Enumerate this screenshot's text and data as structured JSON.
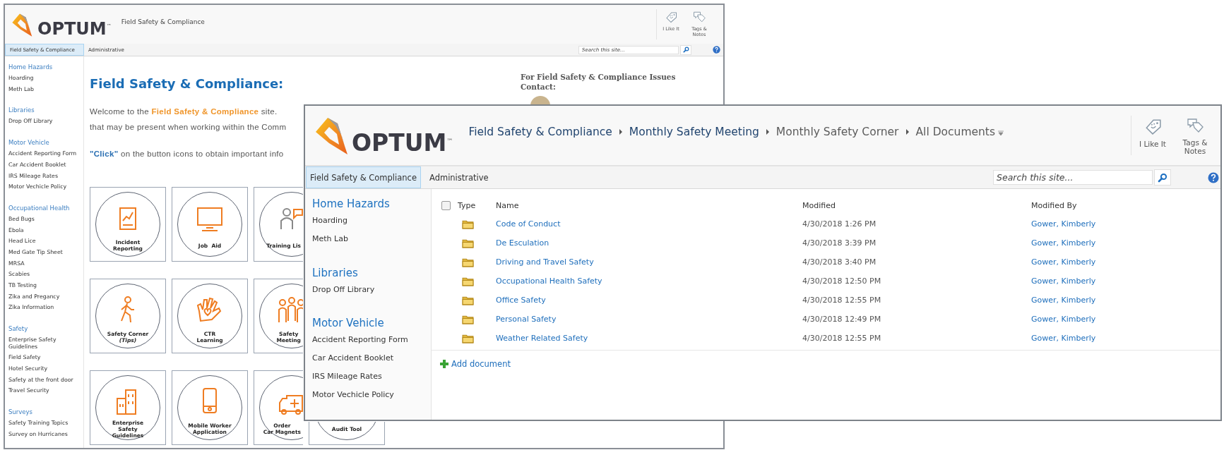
{
  "back_window": {
    "logo": {
      "wordmark": "OPTUM",
      "trademark": "™"
    },
    "site_title": "Field Safety & Compliance",
    "header_actions": [
      {
        "label": "I Like It",
        "kind": "like"
      },
      {
        "label": "Tags & Notes",
        "kind": "tags"
      }
    ],
    "tabs": [
      {
        "label": "Field Safety & Compliance",
        "selected": true
      },
      {
        "label": "Administrative",
        "selected": false
      }
    ],
    "search": {
      "placeholder": "Search this site..."
    },
    "sidebar": [
      {
        "heading": "Home Hazards",
        "items": [
          "Hoarding",
          "Meth Lab"
        ]
      },
      {
        "heading": "Libraries",
        "items": [
          "Drop Off Library"
        ]
      },
      {
        "heading": "Motor Vehicle",
        "items": [
          "Accident Reporting Form",
          "Car Accident Booklet",
          "IRS Mileage Rates",
          "Motor Vechicle Policy"
        ]
      },
      {
        "heading": "Occupational Health",
        "items": [
          "Bed Bugs",
          "Ebola",
          "Head Lice",
          "Med Gate Tip Sheet",
          "MRSA",
          "Scabies",
          "TB Testing",
          "Zika and Pregancy",
          "Zika Information"
        ]
      },
      {
        "heading": "Safety",
        "items": [
          "Enterprise Safety Guidelines",
          "Field Safety",
          "Hotel Security",
          "Safety at the front door",
          "Travel Security"
        ]
      },
      {
        "heading": "Surveys",
        "items": [
          "Safety Training Topics",
          "Survey on Hurricanes"
        ]
      }
    ],
    "page_title": "Field Safety & Compliance:",
    "intro": [
      "Welcome to the **Field Safety & Compliance** site.",
      "that may be present when working within the Comm"
    ],
    "instruction": "**\"Click\"** on the button icons to obtain important info",
    "tiles": [
      [
        {
          "lines": [
            "Incident",
            "Reporting"
          ]
        },
        {
          "lines": [
            "Job  Aid"
          ]
        },
        {
          "lines": [
            "Training Lis"
          ]
        }
      ],
      [
        {
          "lines": [
            "Safety Corner",
            "*(Tips)*"
          ]
        },
        {
          "lines": [
            "CTR",
            "Learning"
          ]
        },
        {
          "lines": [
            "Safety",
            "Meeting"
          ]
        }
      ],
      [
        {
          "lines": [
            "Enterprise",
            "Safety",
            "Guidelines"
          ]
        },
        {
          "lines": [
            "Mobile Worker",
            "Application"
          ]
        },
        {
          "lines": [
            "Order",
            "Car Magnets"
          ]
        },
        {
          "lines": [
            "Audit Tool"
          ]
        }
      ]
    ],
    "contact_heading": "For Field Safety & Compliance Issues Contact:"
  },
  "front_window": {
    "logo": {
      "wordmark": "OPTUM",
      "trademark": "™"
    },
    "breadcrumb": [
      {
        "label": "Field Safety & Compliance",
        "kind": "link"
      },
      {
        "label": "Monthly Safety Meeting",
        "kind": "link"
      },
      {
        "label": "Monthly Safety Corner",
        "kind": "current"
      },
      {
        "label": "All Documents",
        "kind": "view"
      }
    ],
    "header_actions": [
      {
        "label": "I Like It",
        "kind": "like"
      },
      {
        "label": "Tags & Notes",
        "kind": "tags"
      }
    ],
    "tabs": [
      {
        "label": "Field Safety & Compliance",
        "selected": true
      },
      {
        "label": "Administrative",
        "selected": false
      }
    ],
    "search": {
      "placeholder": "Search this site..."
    },
    "sidebar": [
      {
        "heading": "Home Hazards",
        "items": [
          "Hoarding",
          "Meth Lab"
        ]
      },
      {
        "heading": "Libraries",
        "items": [
          "Drop Off Library"
        ]
      },
      {
        "heading": "Motor Vehicle",
        "items": [
          "Accident Reporting Form",
          "Car Accident Booklet",
          "IRS Mileage Rates",
          "Motor Vechicle Policy"
        ]
      }
    ],
    "table": {
      "select_all": {
        "checked": false
      },
      "columns": [
        "Type",
        "Name",
        "Modified",
        "Modified By"
      ],
      "rows": [
        {
          "kind": "folder",
          "name": "Code of Conduct",
          "modified": "4/30/2018 1:26 PM",
          "modified_by": "Gower, Kimberly"
        },
        {
          "kind": "folder",
          "name": "De Esculation",
          "modified": "4/30/2018 3:39 PM",
          "modified_by": "Gower, Kimberly"
        },
        {
          "kind": "folder",
          "name": "Driving and Travel Safety",
          "modified": "4/30/2018 3:40 PM",
          "modified_by": "Gower, Kimberly"
        },
        {
          "kind": "folder",
          "name": "Occupational Health Safety",
          "modified": "4/30/2018 12:50 PM",
          "modified_by": "Gower, Kimberly"
        },
        {
          "kind": "folder",
          "name": "Office Safety",
          "modified": "4/30/2018 12:55 PM",
          "modified_by": "Gower, Kimberly"
        },
        {
          "kind": "folder",
          "name": "Personal Safety",
          "modified": "4/30/2018 12:49 PM",
          "modified_by": "Gower, Kimberly"
        },
        {
          "kind": "folder",
          "name": "Weather Related Safety",
          "modified": "4/30/2018 12:55 PM",
          "modified_by": "Gower, Kimberly"
        }
      ],
      "add_link": "Add document"
    }
  }
}
